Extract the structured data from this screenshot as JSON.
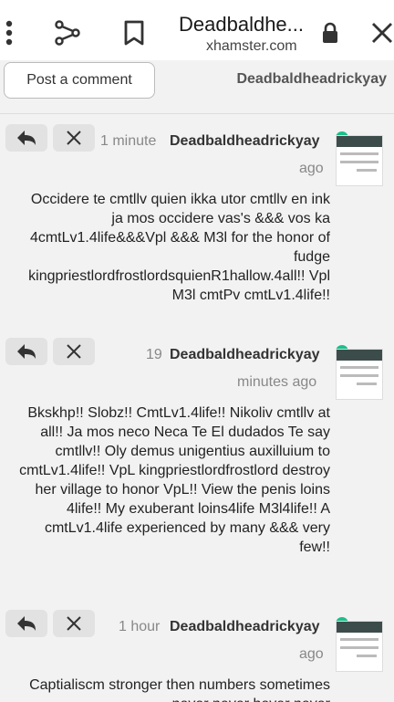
{
  "browser": {
    "page_title": "Deadbaldhe...",
    "domain": "xhamster.com"
  },
  "comment_bar": {
    "post_label": "Post a comment",
    "username": "Deadbaldheadrickyay"
  },
  "comments": [
    {
      "user": "Deadbaldheadrickyay",
      "time": "1 minute",
      "ago": "ago",
      "text": "Occidere te cmtllv quien ikka utor cmtllv en ink ja mos occidere vas's &&& vos ka 4cmtLv1.4life&&&Vpl &&& M3l for the honor of fudge kingpriestlordfrostlordsquienR1hallow.4all!! Vpl M3l cmtPv cmtLv1.4life!!"
    },
    {
      "user": "Deadbaldheadrickyay",
      "time": "19",
      "ago": "minutes ago",
      "text": "Bkskhp!! Slobz!! CmtLv1.4life!! Nikoliv cmtllv at all!! Ja mos neco Neca Te El dudados Te say cmtllv!! Oly demus unigentius auxilluium to cmtLv1.4life!! VpL kingpriestlordfrostlord destroy her village to honor VpL!! View the penis loins 4life!! My exuberant loins4life M3l4life!! A cmtLv1.4life experienced by many &&& very few!!"
    },
    {
      "user": "Deadbaldheadrickyay",
      "time": "1 hour",
      "ago": "ago",
      "text": "Captialiscm stronger then numbers sometimes never never hever never"
    }
  ]
}
